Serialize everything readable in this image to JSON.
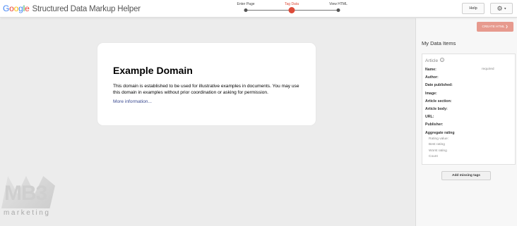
{
  "header": {
    "logo_letters": [
      "G",
      "o",
      "o",
      "g",
      "l",
      "e"
    ],
    "app_name": "Structured Data Markup Helper",
    "steps": [
      {
        "label": "Enter Page",
        "active": false
      },
      {
        "label": "Tag Data",
        "active": true
      },
      {
        "label": "View HTML",
        "active": false
      }
    ],
    "help_label": "Help",
    "settings_icon": "gear-icon",
    "settings_caret": "▾"
  },
  "content": {
    "heading": "Example Domain",
    "paragraph": "This domain is established to be used for illustrative examples in documents. You may use this domain in examples without prior coordination or asking for permission.",
    "link": "More information..."
  },
  "watermark": {
    "mark": "MB3",
    "word": "marketing"
  },
  "panel": {
    "create_label": "CREATE HTML ❯",
    "title": "My Data Items",
    "item_type": "Article",
    "properties": [
      {
        "label": "Name:",
        "note": "required"
      },
      {
        "label": "Author:",
        "note": ""
      },
      {
        "label": "Date published:",
        "note": ""
      },
      {
        "label": "Image:",
        "note": ""
      },
      {
        "label": "Article section:",
        "note": ""
      },
      {
        "label": "Article body:",
        "note": ""
      },
      {
        "label": "URL:",
        "note": ""
      },
      {
        "label": "Publisher:",
        "note": ""
      },
      {
        "label": "Aggregate rating",
        "note": ""
      }
    ],
    "rating_subprops": [
      "Rating value:",
      "Best rating",
      "Worst rating",
      "Count"
    ],
    "add_label": "Add missing tags"
  },
  "colors": {
    "accent_red": "#dd4b39",
    "create_button": "#e79a8e",
    "link": "#38488f",
    "main_bg": "#ececec"
  }
}
